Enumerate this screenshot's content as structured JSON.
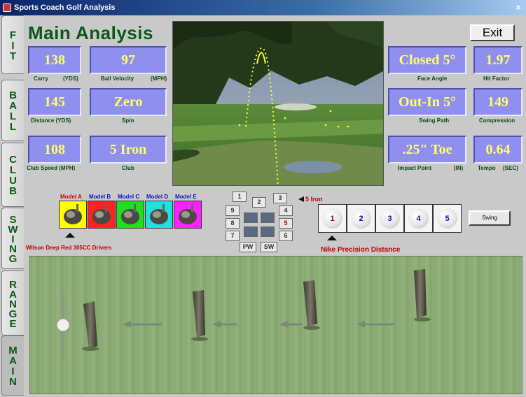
{
  "window": {
    "title": "Sports Coach Golf Analysis",
    "close_label": "×"
  },
  "sidetabs": [
    {
      "label": "FIT",
      "id": "fit"
    },
    {
      "label": "BALL",
      "id": "ball"
    },
    {
      "label": "CLUB",
      "id": "club"
    },
    {
      "label": "SWING",
      "id": "swing"
    },
    {
      "label": "RANGE",
      "id": "range"
    },
    {
      "label": "MAIN",
      "id": "main"
    }
  ],
  "main_title": "Main Analysis",
  "exit_label": "Exit",
  "readouts": {
    "carry": {
      "value": "138",
      "label": "Carry",
      "unit": "(YDS)"
    },
    "ball_velocity": {
      "value": "97",
      "label": "Ball Velocity",
      "unit": "(MPH)"
    },
    "distance": {
      "value": "145",
      "label": "Distance (YDS)"
    },
    "spin": {
      "value": "Zero",
      "label": "Spin"
    },
    "club_speed": {
      "value": "108",
      "label": "Club Speed (MPH)"
    },
    "club": {
      "value": "5 Iron",
      "label": "Club"
    },
    "face_angle": {
      "value": "Closed 5°",
      "label": "Face Angle"
    },
    "hit_factor": {
      "value": "1.97",
      "label": "Hit Factor"
    },
    "swing_path": {
      "value": "Out-In 5°",
      "label": "Swing Path"
    },
    "compression": {
      "value": "149",
      "label": "Compression"
    },
    "impact_point": {
      "value": ".25\" Toe",
      "label": "Impact Point",
      "unit": "(IN)"
    },
    "tempo": {
      "value": "0.64",
      "label": "Tempo",
      "unit": "(SEC)"
    }
  },
  "models": {
    "items": [
      {
        "label": "Model A",
        "label_color": "#cc0000",
        "bg": "#ffff00"
      },
      {
        "label": "Model B",
        "label_color": "#1010cc",
        "bg": "#ff2020"
      },
      {
        "label": "Model C",
        "label_color": "#1010cc",
        "bg": "#20dd20"
      },
      {
        "label": "Model D",
        "label_color": "#1010cc",
        "bg": "#20e0e0"
      },
      {
        "label": "Model E",
        "label_color": "#1010cc",
        "bg": "#ff20ff"
      }
    ],
    "brand": "Wilson Deep Red 305CC Drivers"
  },
  "irons": {
    "labels": [
      "1",
      "2",
      "3",
      "4",
      "5",
      "6",
      "7",
      "8",
      "9",
      "PW",
      "SW"
    ],
    "selected_note": "5 Iron"
  },
  "balls": {
    "items": [
      "1",
      "2",
      "3",
      "4",
      "5"
    ],
    "selected": "1",
    "brand": "Nike Precision Distance"
  },
  "swing_label": "Swing",
  "colors": {
    "readout_bg": "#8f8ff0",
    "readout_text": "#ffff66",
    "label_green": "#0a4a14",
    "title_green": "#0a5a14",
    "accent_red": "#c00000"
  }
}
